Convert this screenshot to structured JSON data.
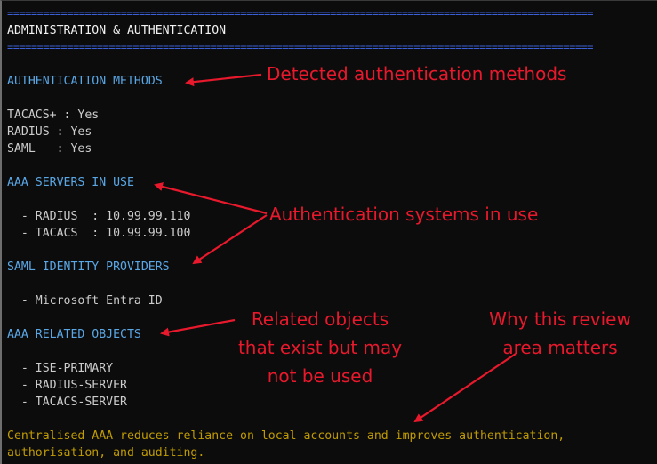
{
  "window": {
    "rule_top": "==================================================================================================",
    "title": "ADMINISTRATION & AUTHENTICATION",
    "rule_bottom": "=================================================================================================="
  },
  "auth_methods": {
    "heading": "AUTHENTICATION METHODS",
    "lines": [
      "TACACS+ : Yes",
      "RADIUS : Yes",
      "SAML   : Yes"
    ]
  },
  "aaa_servers": {
    "heading": "AAA SERVERS IN USE",
    "lines": [
      "  - RADIUS  : 10.99.99.110",
      "  - TACACS  : 10.99.99.100"
    ]
  },
  "saml_providers": {
    "heading": "SAML IDENTITY PROVIDERS",
    "lines": [
      "  - Microsoft Entra ID"
    ]
  },
  "aaa_objects": {
    "heading": "AAA RELATED OBJECTS",
    "lines": [
      "  - ISE-PRIMARY",
      "  - RADIUS-SERVER",
      "  - TACACS-SERVER"
    ]
  },
  "summary": {
    "line1": "Centralised AAA reduces reliance on local accounts and improves authentication,",
    "line2": "authorisation, and auditing."
  },
  "annotations": {
    "detected": "Detected authentication methods",
    "systems": "Authentication systems in use",
    "related_1": "Related objects",
    "related_2": "that exist but may",
    "related_3": "not be used",
    "why_1": "Why this review",
    "why_2": "area matters"
  },
  "colors": {
    "background": "#0c0c0c",
    "heading": "#5aa7e6",
    "rule": "#3b5fd6",
    "summary": "#c19c00",
    "annotation": "#e8192c"
  }
}
